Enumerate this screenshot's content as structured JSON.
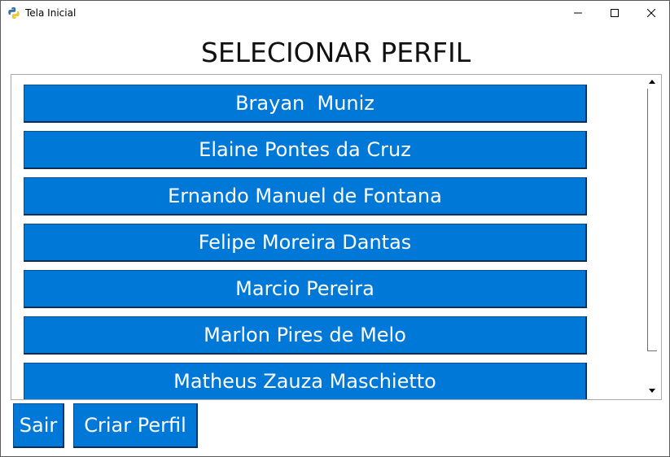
{
  "window": {
    "title": "Tela Inicial",
    "icon": "python-icon"
  },
  "heading": "SELECIONAR PERFIL",
  "profiles": [
    "Brayan  Muniz",
    "Elaine Pontes da Cruz",
    "Ernando Manuel de Fontana",
    "Felipe Moreira Dantas",
    "Marcio Pereira",
    "Marlon Pires de Melo",
    "Matheus Zauza Maschietto",
    ""
  ],
  "buttons": {
    "exit_label": "Sair",
    "create_label": "Criar Perfil"
  },
  "colors": {
    "button_bg": "#0078d7",
    "button_text": "#ffffff"
  }
}
